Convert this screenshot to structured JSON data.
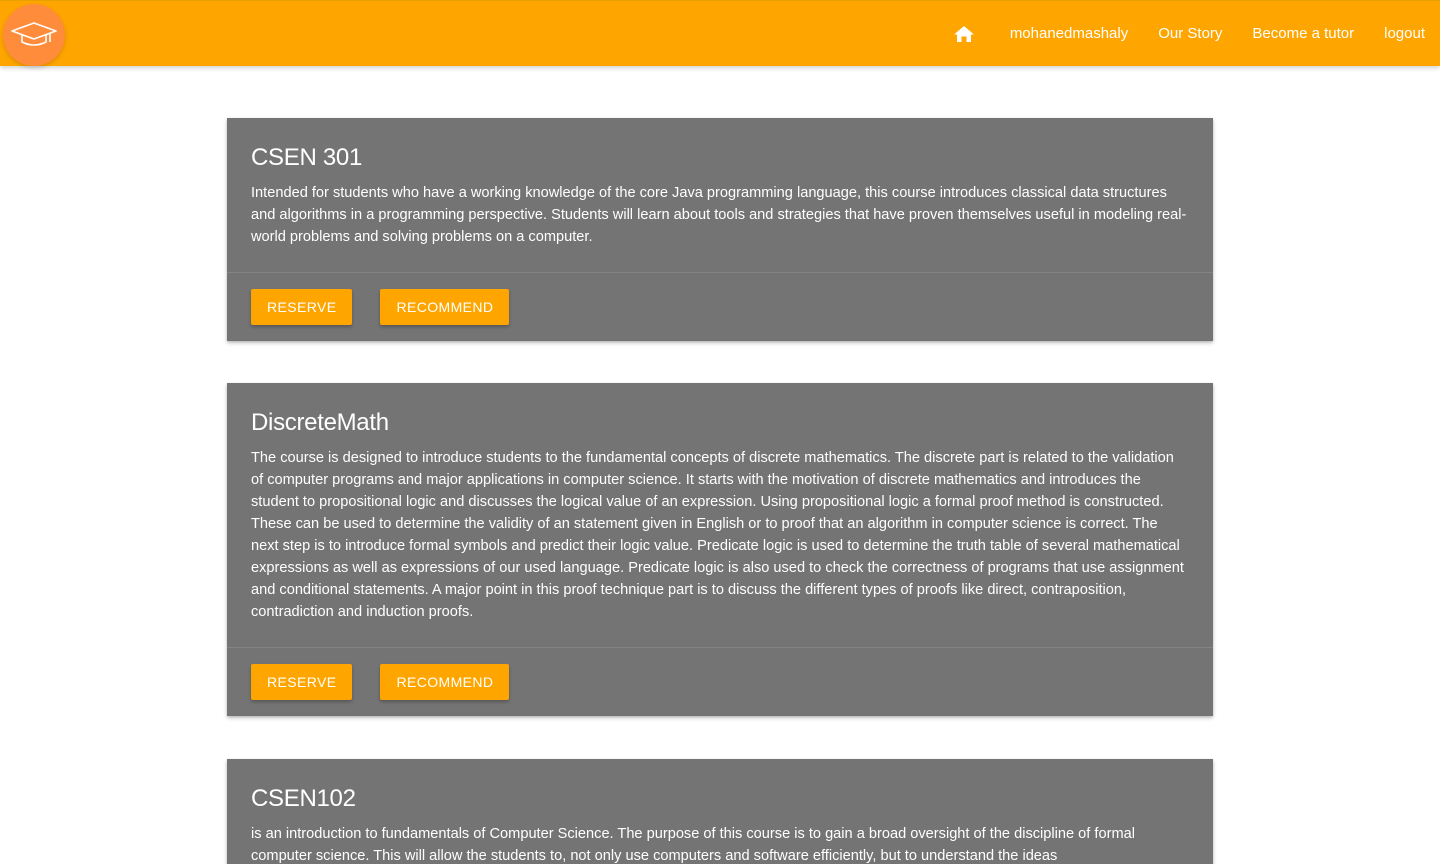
{
  "navbar": {
    "home_icon": "home-icon",
    "logo_icon": "graduation-cap-icon",
    "items": [
      {
        "label": "mohanedmashaly"
      },
      {
        "label": "Our Story"
      },
      {
        "label": "Become a tutor"
      },
      {
        "label": "logout"
      }
    ],
    "colors": {
      "bar": "#ffa500",
      "logo": "#ff8c3a"
    }
  },
  "courses": [
    {
      "title": "CSEN 301",
      "description": "Intended for students who have a working knowledge of the core Java programming language, this course introduces classical data structures and algorithms in a programming perspective. Students will learn about tools and strategies that have proven themselves useful in modeling real-world problems and solving problems on a computer.",
      "reserve_label": "RESERVE",
      "recommend_label": "RECOMMEND"
    },
    {
      "title": "DiscreteMath",
      "description": "The course is designed to introduce students to the fundamental concepts of discrete mathematics. The discrete part is related to the validation of computer programs and major applications in computer science. It starts with the motivation of discrete mathematics and introduces the student to propositional logic and discusses the logical value of an expression. Using propositional logic a formal proof method is constructed. These can be used to determine the validity of an statement given in English or to proof that an algorithm in computer science is correct. The next step is to introduce formal symbols and predict their logic value. Predicate logic is used to determine the truth table of several mathematical expressions as well as expressions of our used language. Predicate logic is also used to check the correctness of programs that use assignment and conditional statements. A major point in this proof technique part is to discuss the different types of proofs like direct, contraposition, contradiction and induction proofs.",
      "reserve_label": "RESERVE",
      "recommend_label": "RECOMMEND"
    },
    {
      "title": "CSEN102",
      "description": "is an introduction to fundamentals of Computer Science. The purpose of this course is to gain a broad oversight of the discipline of formal computer science. This will allow the students to, not only use computers and software efficiently, but to understand the ideas"
    }
  ],
  "colors": {
    "card": "#747474",
    "button": "#ffa500"
  }
}
